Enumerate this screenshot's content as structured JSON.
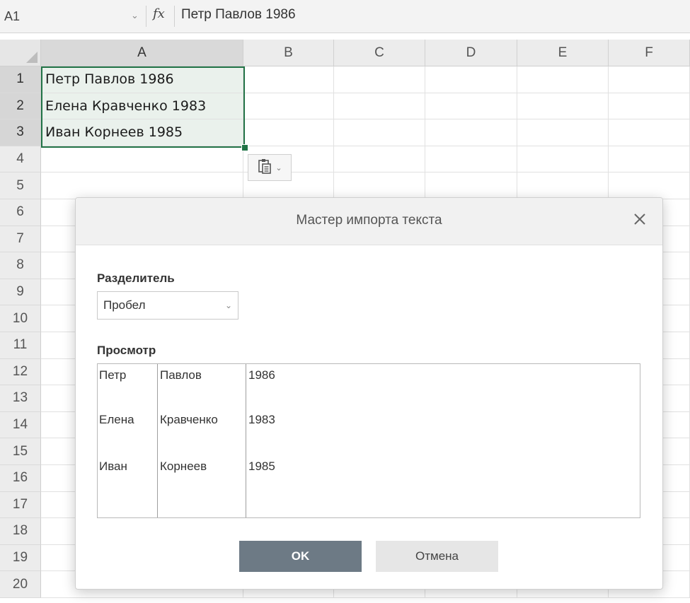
{
  "formula_bar": {
    "cell_ref": "A1",
    "fx_label": "fx",
    "formula": "Петр Павлов 1986"
  },
  "sheet": {
    "columns": [
      "A",
      "B",
      "C",
      "D",
      "E",
      "F"
    ],
    "rows": [
      "1",
      "2",
      "3",
      "4",
      "5",
      "6",
      "7",
      "8",
      "9",
      "10",
      "11",
      "12",
      "13",
      "14",
      "15",
      "16",
      "17",
      "18",
      "19",
      "20"
    ],
    "cells": {
      "A1": "Петр Павлов 1986",
      "A2": "Елена Кравченко 1983",
      "A3": "Иван Корнеев 1985"
    }
  },
  "dialog": {
    "title": "Мастер импорта текста",
    "delimiter_label": "Разделитель",
    "delimiter_value": "Пробел",
    "preview_label": "Просмотр",
    "preview_rows": [
      [
        "Петр",
        "Павлов",
        "1986"
      ],
      [
        "Елена",
        "Кравченко",
        "1983"
      ],
      [
        "Иван",
        "Корнеев",
        "1985"
      ]
    ],
    "ok_label": "OK",
    "cancel_label": "Отмена"
  },
  "icons": {
    "close": "close-icon",
    "paste": "paste-icon",
    "dropdown": "chevron-down-icon"
  },
  "colors": {
    "selection": "#217346",
    "ok_button": "#6d7a85"
  }
}
